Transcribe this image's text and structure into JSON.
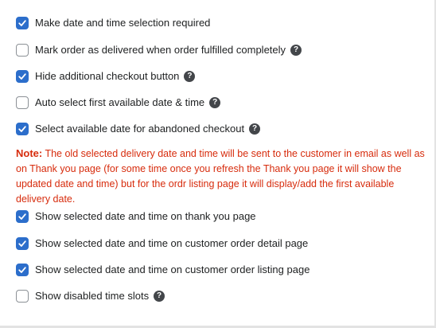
{
  "options": [
    {
      "label": "Make date and time selection required",
      "checked": true,
      "help": false
    },
    {
      "label": "Mark order as delivered when order fulfilled completely",
      "checked": false,
      "help": true
    },
    {
      "label": "Hide additional checkout button",
      "checked": true,
      "help": true
    },
    {
      "label": "Auto select first available date & time",
      "checked": false,
      "help": true
    },
    {
      "label": "Select available date for abandoned checkout",
      "checked": true,
      "help": true
    },
    {
      "label": "Show selected date and time on thank you page",
      "checked": true,
      "help": false
    },
    {
      "label": "Show selected date and time on customer order detail page",
      "checked": true,
      "help": false
    },
    {
      "label": "Show selected date and time on customer order listing page",
      "checked": true,
      "help": false
    },
    {
      "label": "Show disabled time slots",
      "checked": false,
      "help": true
    }
  ],
  "note": {
    "label": "Note:",
    "text": "The old selected delivery date and time will be sent to the customer in email as well as on Thank you page (for some time once you refresh the Thank you page it will show the updated date and time) but for the ordr listing page it will display/add the first available delivery date."
  },
  "help_glyph": "?",
  "icons": {
    "checked": "checkmark-icon",
    "help": "question-circle-icon"
  },
  "colors": {
    "checkbox_checked": "#2c6ecb",
    "note_text": "#d72c0d",
    "help_icon": "#43464a"
  }
}
